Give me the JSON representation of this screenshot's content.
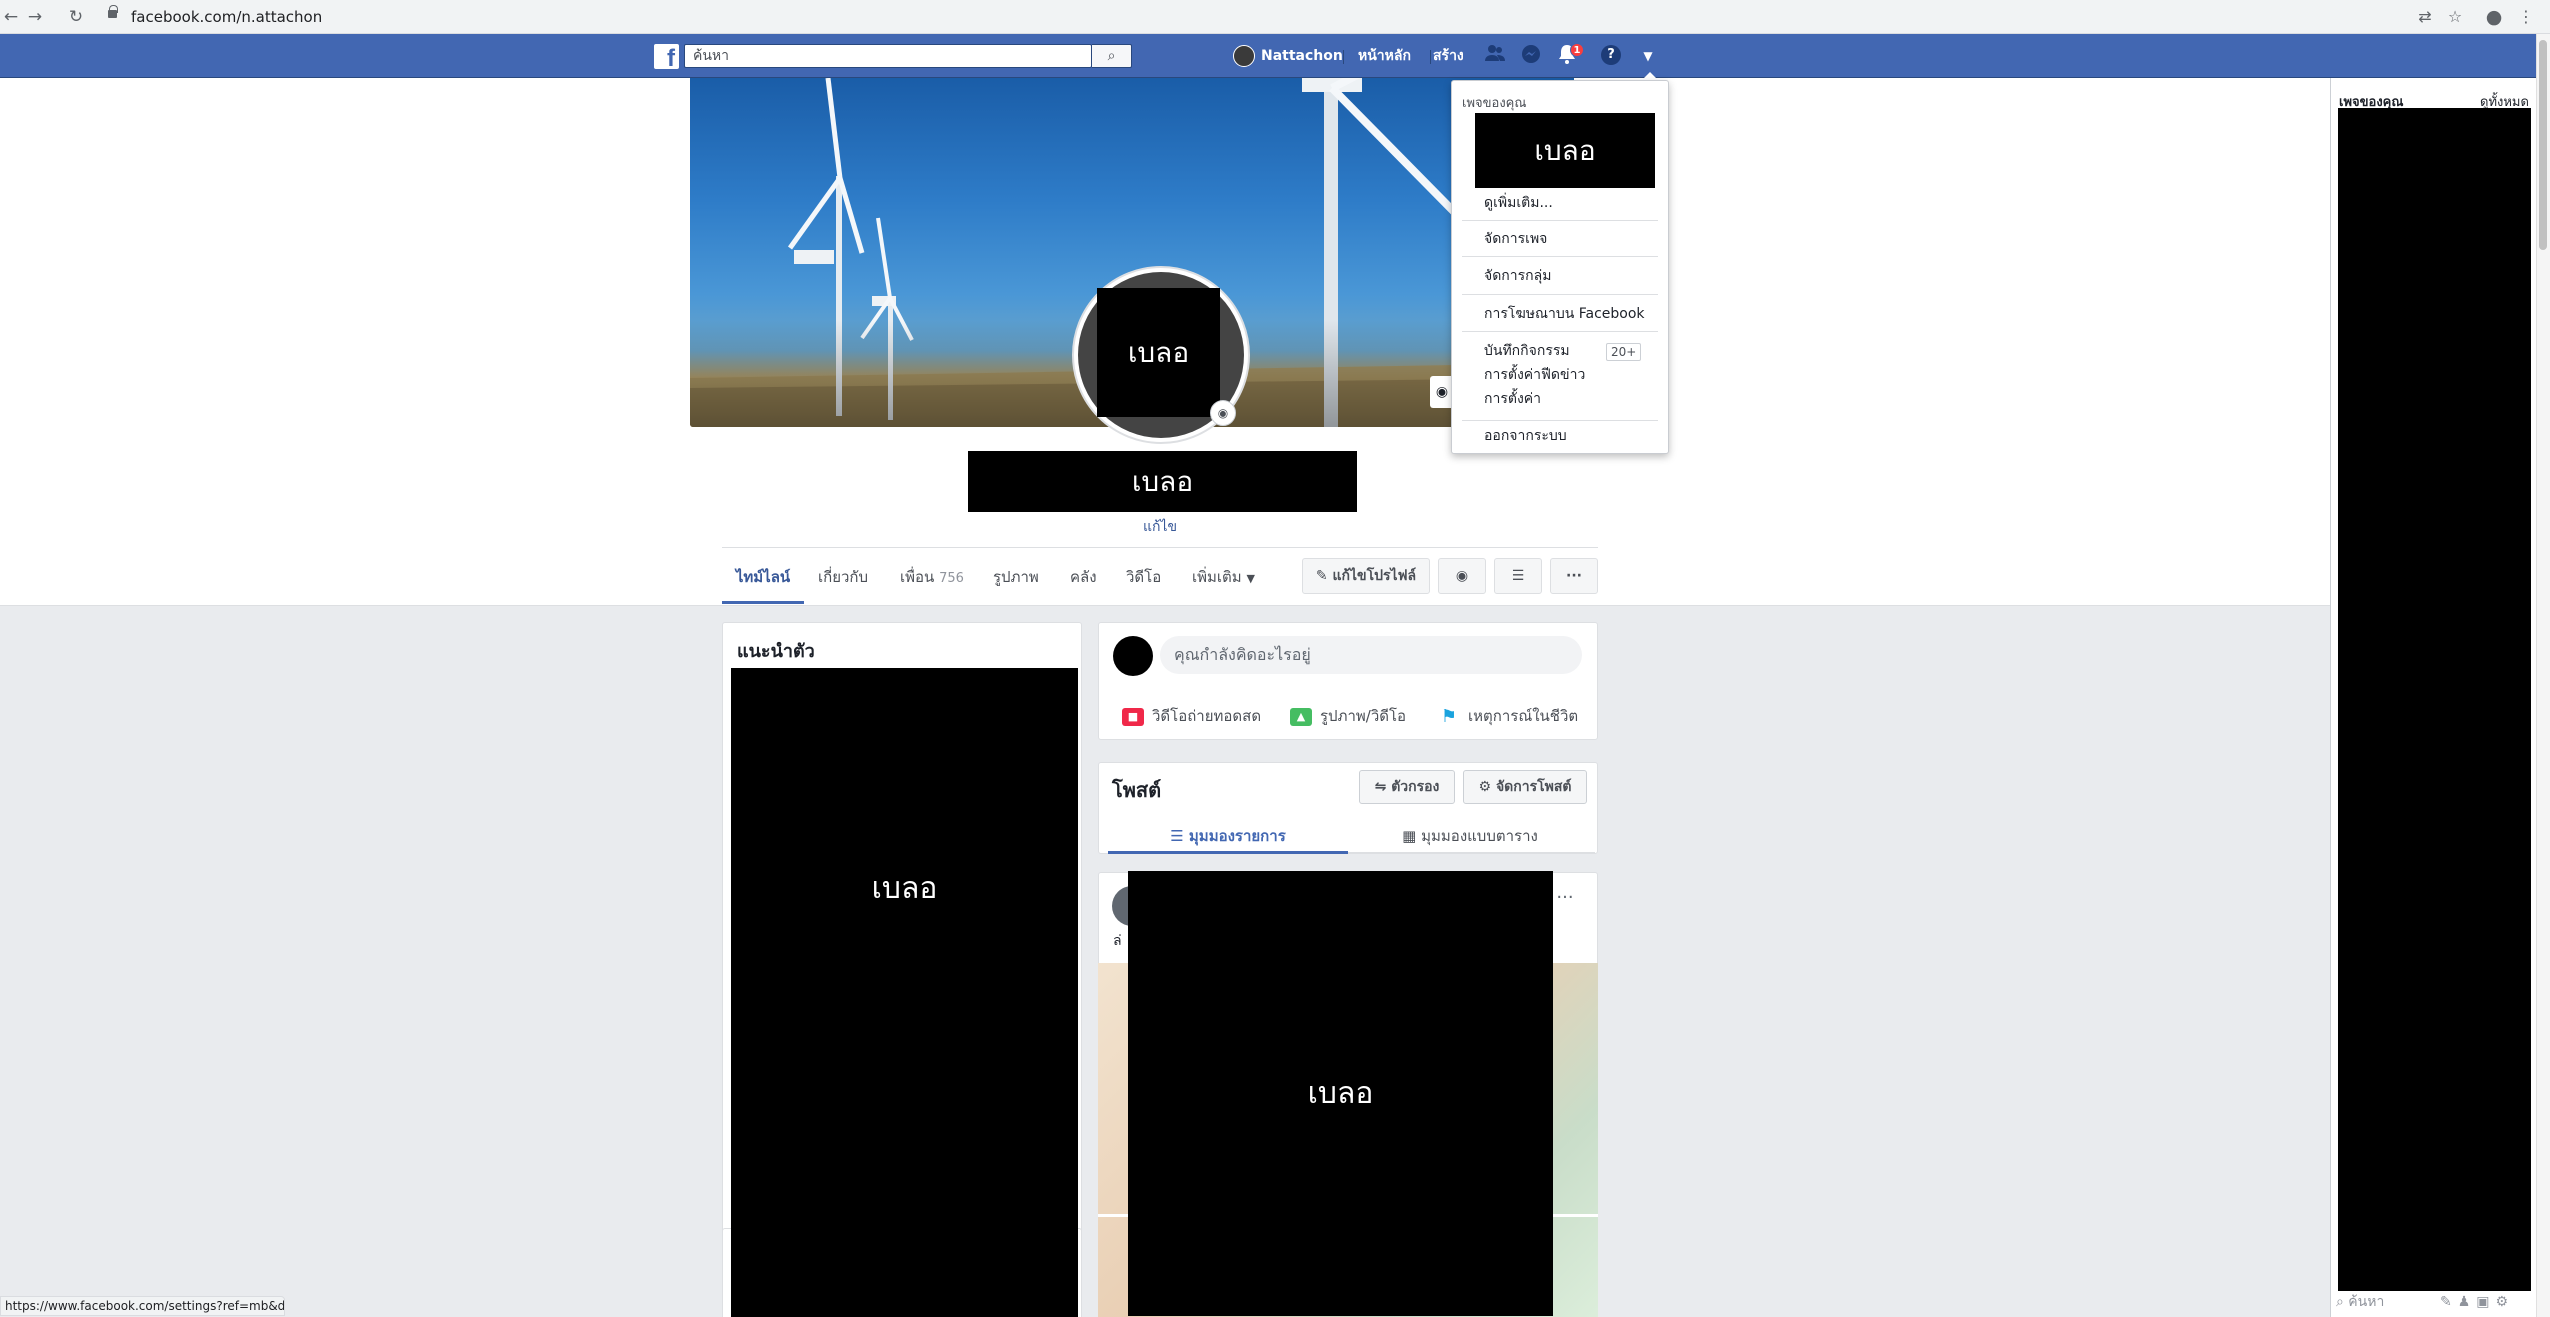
{
  "browser": {
    "url": "facebook.com/n.attachon",
    "status_url": "https://www.facebook.com/settings?ref=mb&drop"
  },
  "topbar": {
    "search_placeholder": "ค้นหา",
    "user_name": "Nattachon",
    "home": "หน้าหลัก",
    "create": "สร้าง",
    "notification_count": "1",
    "brand_color": "#4267b2"
  },
  "profile": {
    "name_blur": "เบลอ",
    "avatar_blur": "เบลอ",
    "edit": "แก้ไข",
    "tabs": {
      "timeline": "ไทม์ไลน์",
      "about": "เกี่ยวกับ",
      "friends": "เพื่อน",
      "friends_count": "756",
      "photos": "รูปภาพ",
      "archive": "คลัง",
      "videos": "วิดีโอ",
      "more": "เพิ่มเติม"
    },
    "edit_profile_button": "แก้ไขโปรไฟล์"
  },
  "intro": {
    "title": "แนะนำตัว",
    "blur": "เบลอ"
  },
  "composer": {
    "placeholder": "คุณกำลังคิดอะไรอยู่",
    "live_video": "วิดีโอถ่ายทอดสด",
    "photo_video": "รูปภาพ/วิดีโอ",
    "life_event": "เหตุการณ์ในชีวิต"
  },
  "posts": {
    "title": "โพสต์",
    "filter": "ตัวกรอง",
    "manage": "จัดการโพสต์",
    "list_view": "มุมมองรายการ",
    "grid_view": "มุมมองแบบตาราง",
    "post_blur": "เบลอ",
    "post_text_fragment": "ล่"
  },
  "dropdown": {
    "header": "เพจของคุณ",
    "blur": "เบลอ",
    "see_more": "ดูเพิ่มเติม...",
    "manage_pages": "จัดการเพจ",
    "manage_groups": "จัดการกลุ่ม",
    "advertising": "การโฆษณาบน Facebook",
    "activity_log": "บันทึกกิจกรรม",
    "activity_badge": "20+",
    "news_feed_prefs": "การตั้งค่าฟีดข่าว",
    "settings": "การตั้งค่า",
    "log_out": "ออกจากระบบ"
  },
  "right_sidebar": {
    "title": "เพจของคุณ",
    "see_all": "ดูทั้งหมด",
    "search": "ค้นหา"
  }
}
